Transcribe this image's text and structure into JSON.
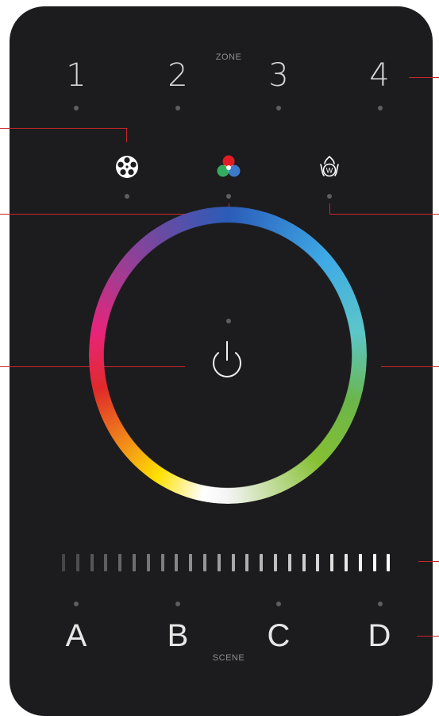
{
  "zone": {
    "label": "ZONE",
    "numbers": [
      "1",
      "2",
      "3",
      "4"
    ]
  },
  "modes": [
    {
      "name": "color-wheel-mode",
      "icon": "film-reel-icon"
    },
    {
      "name": "rgb-mode",
      "icon": "rgb-circles-icon"
    },
    {
      "name": "white-mode",
      "icon": "white-w-icon",
      "glyph": "W"
    }
  ],
  "power": {
    "icon": "power-icon"
  },
  "brightness": {
    "level": 1.0,
    "segments": 24
  },
  "scene": {
    "label": "SCENE",
    "letters": [
      "A",
      "B",
      "C",
      "D"
    ]
  },
  "colors": {
    "panel": "#1c1c1e",
    "callout_line": "#c8262d",
    "indicator_dot": "#5e5e5e"
  }
}
